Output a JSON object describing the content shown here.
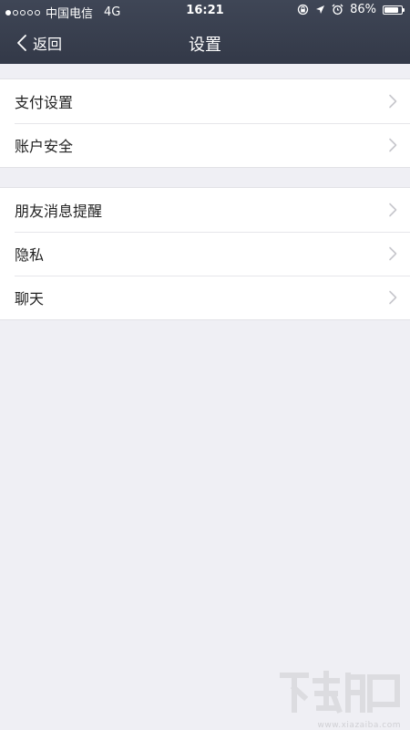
{
  "status_bar": {
    "carrier": "中国电信",
    "network": "4G",
    "time": "16:21",
    "battery_percent": "86%",
    "battery_level": 0.86,
    "icons": [
      "orientation-lock-icon",
      "location-arrow-icon",
      "alarm-icon",
      "battery-icon"
    ]
  },
  "nav": {
    "back_label": "返回",
    "title": "设置"
  },
  "groups": [
    {
      "items": [
        {
          "label": "支付设置"
        },
        {
          "label": "账户安全"
        }
      ]
    },
    {
      "items": [
        {
          "label": "朋友消息提醒"
        },
        {
          "label": "隐私"
        },
        {
          "label": "聊天"
        }
      ]
    }
  ],
  "watermark": {
    "url": "www.xiazaiba.com"
  },
  "colors": {
    "header_bg": "#3b4252",
    "page_bg": "#efeff4",
    "chevron": "#c7c7cc"
  }
}
